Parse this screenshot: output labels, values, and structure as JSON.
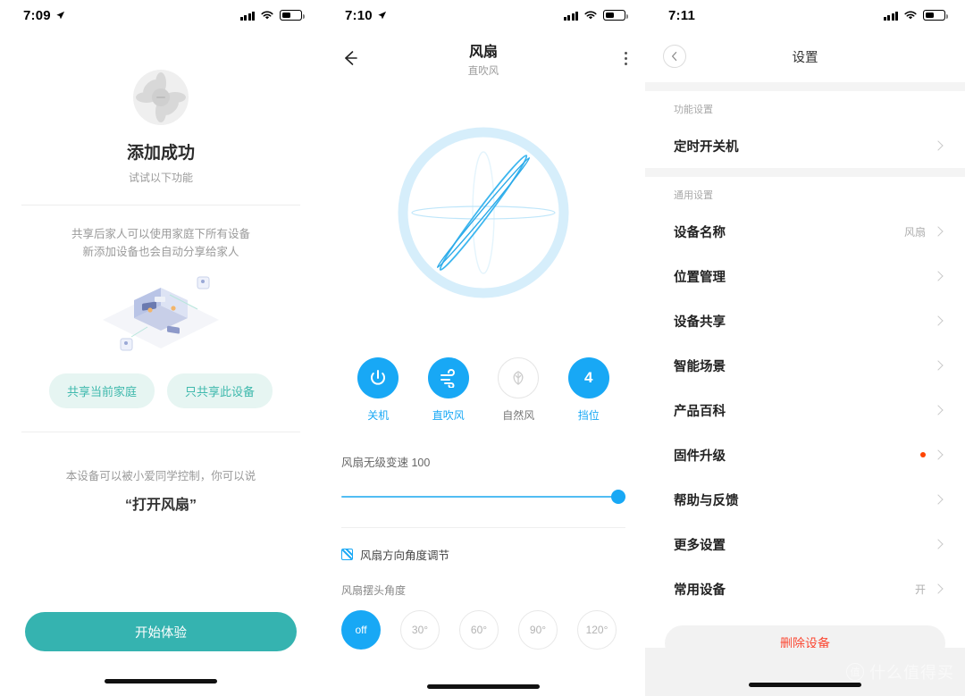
{
  "panel1": {
    "statusbar": {
      "time": "7:09",
      "location_icon": "location-arrow-icon",
      "signal_icon": "signal-bars-icon",
      "wifi_icon": "wifi-icon",
      "battery_icon": "battery-icon"
    },
    "device_icon": "fan-icon",
    "title": "添加成功",
    "subtitle": "试试以下功能",
    "share_desc_line1": "共享后家人可以使用家庭下所有设备",
    "share_desc_line2": "新添加设备也会自动分享给家人",
    "illustration": "isometric-room-share-illustration",
    "share_buttons": [
      {
        "label": "共享当前家庭",
        "name": "share-current-home-button"
      },
      {
        "label": "只共享此设备",
        "name": "share-this-device-only-button"
      }
    ],
    "voice_line1": "本设备可以被小爱同学控制，你可以说",
    "voice_line2": "“打开风扇”",
    "start_button": "开始体验",
    "accent_teal": "#35b3b0",
    "share_btn_bg": "#e6f5f2"
  },
  "panel2": {
    "statusbar": {
      "time": "7:10"
    },
    "back_icon": "arrow-left-icon",
    "title": "风扇",
    "subtitle": "直吹风",
    "menu_icon": "more-vertical-icon",
    "fan_visual": "fan-blades-animation",
    "modes": [
      {
        "label": "关机",
        "icon": "power-icon",
        "active": true,
        "name": "mode-power-off"
      },
      {
        "label": "直吹风",
        "icon": "wind-icon",
        "active": true,
        "name": "mode-direct-wind"
      },
      {
        "label": "自然风",
        "icon": "leaf-icon",
        "active": false,
        "name": "mode-natural-wind"
      },
      {
        "label": "挡位",
        "icon": "gear-level",
        "value": "4",
        "active": true,
        "name": "mode-speed-level"
      }
    ],
    "slider": {
      "label": "风扇无级变速 100",
      "value": 100,
      "min": 0,
      "max": 100
    },
    "checkbox": {
      "label": "风扇方向角度调节",
      "checked": true
    },
    "angle_label": "风扇摆头角度",
    "angles": [
      {
        "label": "off",
        "selected": true,
        "name": "angle-off"
      },
      {
        "label": "30°",
        "selected": false,
        "name": "angle-30"
      },
      {
        "label": "60°",
        "selected": false,
        "name": "angle-60"
      },
      {
        "label": "90°",
        "selected": false,
        "name": "angle-90"
      },
      {
        "label": "120°",
        "selected": false,
        "name": "angle-120"
      }
    ],
    "accent_blue": "#18a8f5"
  },
  "panel3": {
    "statusbar": {
      "time": "7:11"
    },
    "back_icon": "chevron-left-circle-icon",
    "title": "设置",
    "sections": [
      {
        "header": "功能设置",
        "rows": [
          {
            "label": "定时开关机",
            "value": "",
            "dot": false,
            "name": "row-timer-switch"
          }
        ]
      },
      {
        "header": "通用设置",
        "rows": [
          {
            "label": "设备名称",
            "value": "风扇",
            "dot": false,
            "name": "row-device-name"
          },
          {
            "label": "位置管理",
            "value": "",
            "dot": false,
            "name": "row-location-management"
          },
          {
            "label": "设备共享",
            "value": "",
            "dot": false,
            "name": "row-device-sharing"
          },
          {
            "label": "智能场景",
            "value": "",
            "dot": false,
            "name": "row-smart-scene"
          },
          {
            "label": "产品百科",
            "value": "",
            "dot": false,
            "name": "row-product-wiki"
          },
          {
            "label": "固件升级",
            "value": "",
            "dot": true,
            "name": "row-firmware-upgrade"
          },
          {
            "label": "帮助与反馈",
            "value": "",
            "dot": false,
            "name": "row-help-feedback"
          },
          {
            "label": "更多设置",
            "value": "",
            "dot": false,
            "name": "row-more-settings"
          },
          {
            "label": "常用设备",
            "value": "开",
            "dot": false,
            "name": "row-favorite-device"
          }
        ]
      }
    ],
    "delete_button": "删除设备",
    "delete_color": "#fb4a35",
    "watermark": {
      "badge": "值",
      "text": "什么值得买"
    }
  }
}
